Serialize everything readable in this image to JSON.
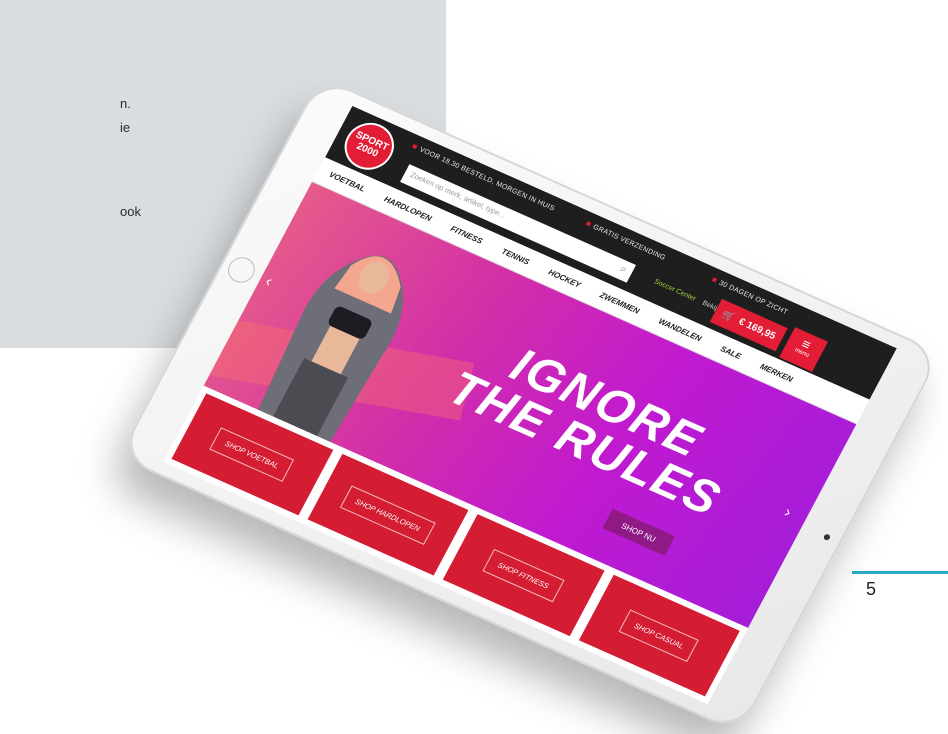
{
  "page": {
    "panel_fragments": [
      "n.",
      "ie",
      "ook"
    ],
    "page_number": "5"
  },
  "site": {
    "logo": {
      "line1": "SPORT",
      "line2": "2000"
    },
    "usps": [
      "VOOR 18.30 BESTELD, MORGEN IN HUIS",
      "GRATIS VERZENDING",
      "30 DAGEN OP ZICHT"
    ],
    "search_placeholder": "Zoeken op merk, artikel, type...",
    "stores_highlight": "Soccer Center",
    "stores_text": "Bekijk onze 89 winkels",
    "cart_total": "€ 169,95",
    "menu_label": "menu",
    "nav": [
      "VOETBAL",
      "HARDLOPEN",
      "FITNESS",
      "TENNIS",
      "HOCKEY",
      "ZWEMMEN",
      "WANDELEN",
      "SALE",
      "MERKEN"
    ],
    "hero": {
      "line1": "IGNORE",
      "line2": "THE RULES",
      "cta": "SHOP NU"
    },
    "categories": [
      "SHOP VOETBAL",
      "SHOP HARDLOPEN",
      "SHOP FITNESS",
      "SHOP CASUAL"
    ]
  },
  "colors": {
    "brand_red": "#e31d36",
    "hero_magenta": "#c01ad0",
    "accent_line": "#2aa9c9"
  }
}
